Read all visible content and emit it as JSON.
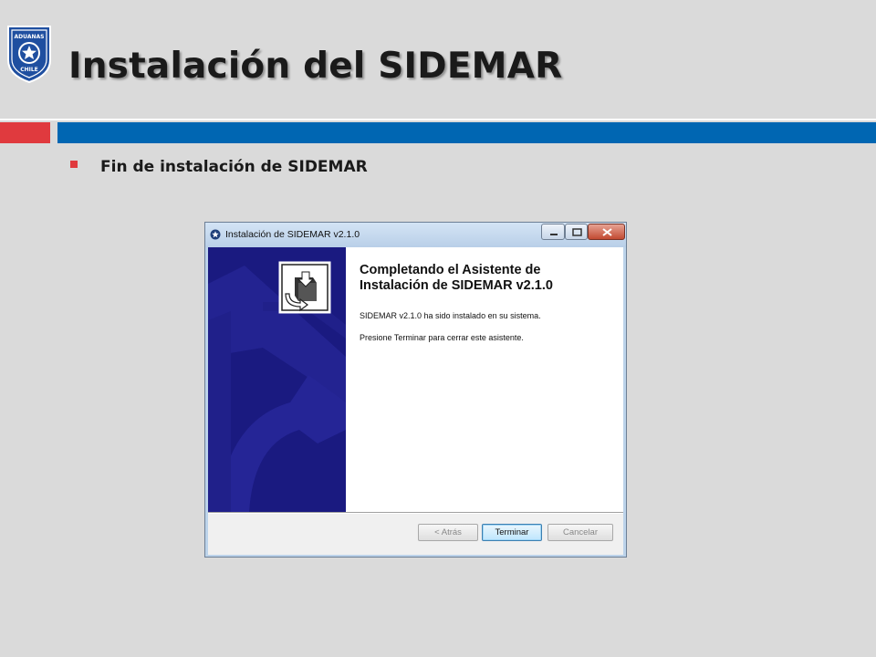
{
  "slide": {
    "title": "Instalación del SIDEMAR",
    "bullet": "Fin de instalación de SIDEMAR",
    "logo": {
      "icon": "aduanas-chile-shield-logo",
      "text_top": "ADUANAS",
      "text_bottom": "CHILE"
    }
  },
  "colors": {
    "accent_red": "#e03a3e",
    "accent_blue": "#0066b2",
    "installer_panel": "#1a1a80"
  },
  "dialog": {
    "title": "Instalación de SIDEMAR v2.1.0",
    "title_icon": "star-badge-icon",
    "heading": "Completando el Asistente de Instalación de SIDEMAR v2.1.0",
    "message_1": "SIDEMAR v2.1.0 ha sido instalado en su sistema.",
    "message_2": "Presione Terminar para cerrar este asistente.",
    "buttons": {
      "back": "< Atrás",
      "finish": "Terminar",
      "cancel": "Cancelar"
    },
    "window_controls": [
      "minimize-icon",
      "maximize-icon",
      "close-icon"
    ]
  }
}
